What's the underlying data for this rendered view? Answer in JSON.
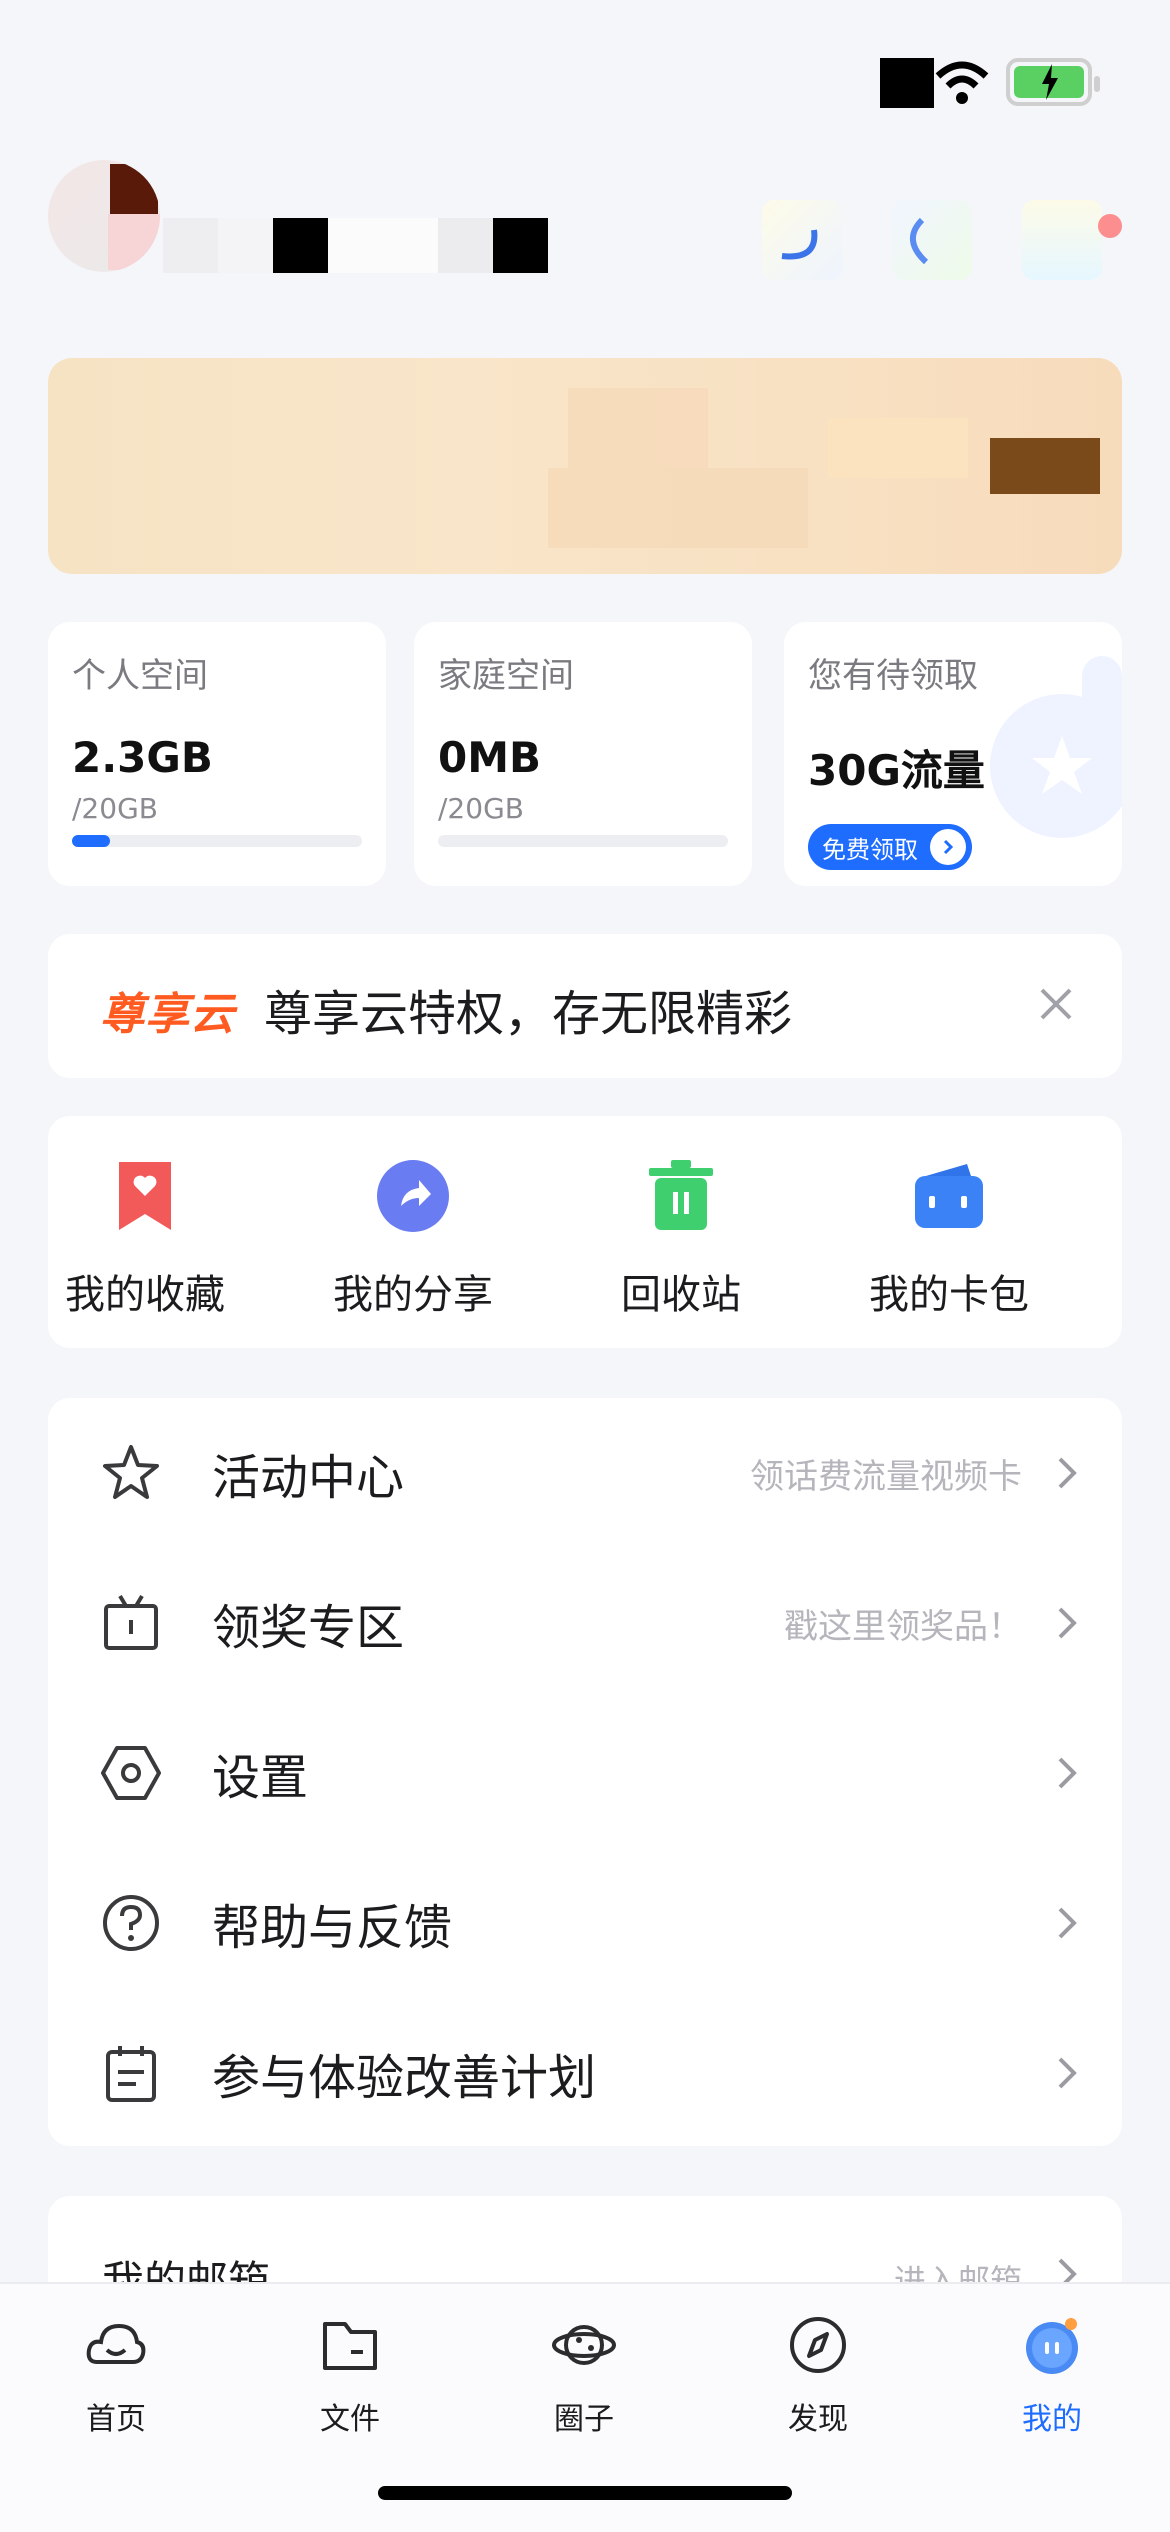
{
  "profile": {
    "name_masked": ""
  },
  "storage_cards": [
    {
      "label": "个人空间",
      "used": "2.3GB",
      "total": "/20GB",
      "progress": 0.13
    },
    {
      "label": "家庭空间",
      "used": "0MB",
      "total": "/20GB",
      "progress": 0
    },
    {
      "label": "您有待领取",
      "value": "30G流量",
      "button": "免费领取"
    }
  ],
  "vip": {
    "logo": "尊享云",
    "text": "尊享云特权，存无限精彩"
  },
  "quick_actions": [
    {
      "label": "我的收藏",
      "icon": "bookmark-heart-icon"
    },
    {
      "label": "我的分享",
      "icon": "share-icon"
    },
    {
      "label": "回收站",
      "icon": "trash-icon"
    },
    {
      "label": "我的卡包",
      "icon": "wallet-icon"
    }
  ],
  "menu": [
    {
      "title": "活动中心",
      "hint": "领话费流量视频卡",
      "icon": "star-icon"
    },
    {
      "title": "领奖专区",
      "hint": "戳这里领奖品！",
      "icon": "tv-icon"
    },
    {
      "title": "设置",
      "hint": "",
      "icon": "settings-hexagon-icon"
    },
    {
      "title": "帮助与反馈",
      "hint": "",
      "icon": "help-icon"
    },
    {
      "title": "参与体验改善计划",
      "hint": "",
      "icon": "clipboard-icon"
    }
  ],
  "mailbox": {
    "title": "我的邮箱",
    "hint": "进入邮箱"
  },
  "tabs": [
    {
      "label": "首页",
      "icon": "cloud-icon"
    },
    {
      "label": "文件",
      "icon": "folder-icon"
    },
    {
      "label": "圈子",
      "icon": "planet-icon"
    },
    {
      "label": "发现",
      "icon": "compass-icon"
    },
    {
      "label": "我的",
      "icon": "mascot-icon",
      "active": true
    }
  ],
  "colors": {
    "accent": "#1e6dff",
    "background": "#f5f6fa",
    "vip_orange": "#ff5a1f"
  }
}
